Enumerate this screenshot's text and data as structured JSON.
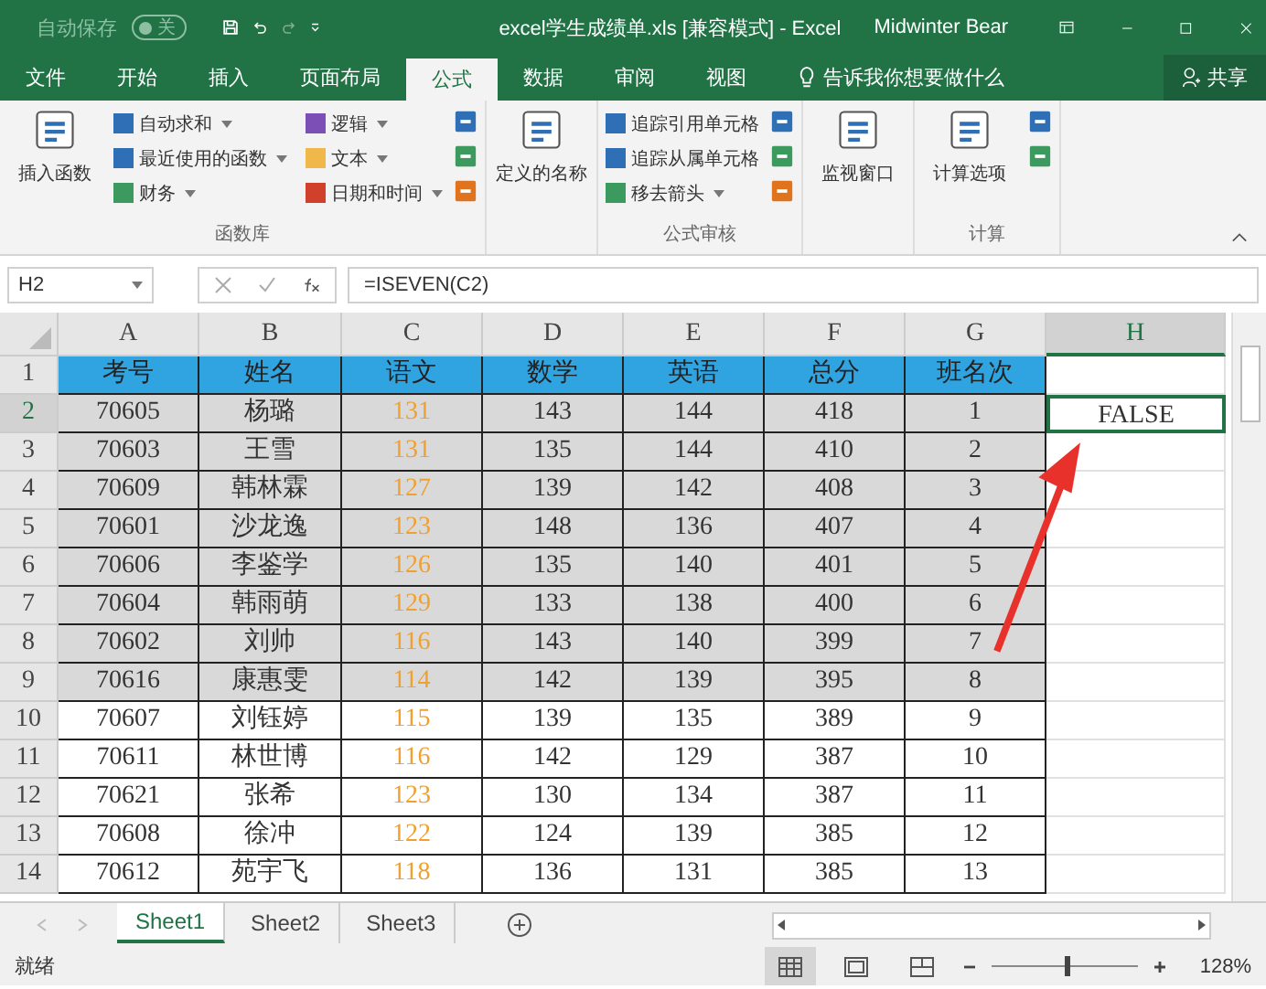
{
  "title_bar": {
    "autosave": {
      "label": "自动保存",
      "state_text": "关",
      "on": false
    },
    "title": "excel学生成绩单.xls  [兼容模式]  -  Excel",
    "user": "Midwinter Bear"
  },
  "menu_tabs": [
    {
      "label": "文件",
      "selected": false
    },
    {
      "label": "开始",
      "selected": false
    },
    {
      "label": "插入",
      "selected": false
    },
    {
      "label": "页面布局",
      "selected": false
    },
    {
      "label": "公式",
      "selected": true
    },
    {
      "label": "数据",
      "selected": false
    },
    {
      "label": "审阅",
      "selected": false
    },
    {
      "label": "视图",
      "selected": false
    }
  ],
  "tell_me": "告诉我你想要做什么",
  "share": "共享",
  "ribbon": {
    "groups": [
      {
        "label": "函数库",
        "large": [
          "插入函数"
        ],
        "small": [
          {
            "label": "自动求和",
            "dropdown": true
          },
          {
            "label": "最近使用的函数",
            "dropdown": true
          },
          {
            "label": "财务",
            "dropdown": true
          },
          {
            "label": "逻辑",
            "dropdown": true
          },
          {
            "label": "文本",
            "dropdown": true
          },
          {
            "label": "日期和时间",
            "dropdown": true
          }
        ]
      },
      {
        "large": [
          "定义的名称"
        ]
      },
      {
        "label": "公式审核",
        "small": [
          {
            "label": "追踪引用单元格",
            "dropdown": false
          },
          {
            "label": "追踪从属单元格",
            "dropdown": false
          },
          {
            "label": "移去箭头",
            "dropdown": true
          }
        ]
      },
      {
        "large": [
          "监视窗口"
        ]
      },
      {
        "label": "计算",
        "large": [
          "计算选项"
        ]
      }
    ]
  },
  "formula_bar": {
    "name_box": "H2",
    "formula": "=ISEVEN(C2)"
  },
  "columns": [
    {
      "label": "A",
      "selected": false
    },
    {
      "label": "B",
      "selected": false
    },
    {
      "label": "C",
      "selected": false
    },
    {
      "label": "D",
      "selected": false
    },
    {
      "label": "E",
      "selected": false
    },
    {
      "label": "F",
      "selected": false
    },
    {
      "label": "G",
      "selected": false
    },
    {
      "label": "H",
      "selected": true
    }
  ],
  "rows": [
    {
      "num": "1",
      "kind": "header",
      "selected": false,
      "cells": [
        "考号",
        "姓名",
        "语文",
        "数学",
        "英语",
        "总分",
        "班名次"
      ]
    },
    {
      "num": "2",
      "kind": "shaded",
      "selected": true,
      "cells": [
        "70605",
        "杨璐",
        "131",
        "143",
        "144",
        "418",
        "1",
        "FALSE"
      ]
    },
    {
      "num": "3",
      "kind": "shaded",
      "selected": false,
      "cells": [
        "70603",
        "王雪",
        "131",
        "135",
        "144",
        "410",
        "2"
      ]
    },
    {
      "num": "4",
      "kind": "shaded",
      "selected": false,
      "cells": [
        "70609",
        "韩林霖",
        "127",
        "139",
        "142",
        "408",
        "3"
      ]
    },
    {
      "num": "5",
      "kind": "shaded",
      "selected": false,
      "cells": [
        "70601",
        "沙龙逸",
        "123",
        "148",
        "136",
        "407",
        "4"
      ]
    },
    {
      "num": "6",
      "kind": "shaded",
      "selected": false,
      "cells": [
        "70606",
        "李鉴学",
        "126",
        "135",
        "140",
        "401",
        "5"
      ]
    },
    {
      "num": "7",
      "kind": "shaded",
      "selected": false,
      "cells": [
        "70604",
        "韩雨萌",
        "129",
        "133",
        "138",
        "400",
        "6"
      ]
    },
    {
      "num": "8",
      "kind": "shaded",
      "selected": false,
      "cells": [
        "70602",
        "刘帅",
        "116",
        "143",
        "140",
        "399",
        "7"
      ]
    },
    {
      "num": "9",
      "kind": "shaded",
      "selected": false,
      "cells": [
        "70616",
        "康惠雯",
        "114",
        "142",
        "139",
        "395",
        "8"
      ]
    },
    {
      "num": "10",
      "kind": "plain",
      "selected": false,
      "cells": [
        "70607",
        "刘钰婷",
        "115",
        "139",
        "135",
        "389",
        "9"
      ]
    },
    {
      "num": "11",
      "kind": "plain",
      "selected": false,
      "cells": [
        "70611",
        "林世博",
        "116",
        "142",
        "129",
        "387",
        "10"
      ]
    },
    {
      "num": "12",
      "kind": "plain",
      "selected": false,
      "cells": [
        "70621",
        "张希",
        "123",
        "130",
        "134",
        "387",
        "11"
      ]
    },
    {
      "num": "13",
      "kind": "plain",
      "selected": false,
      "cells": [
        "70608",
        "徐冲",
        "122",
        "124",
        "139",
        "385",
        "12"
      ]
    },
    {
      "num": "14",
      "kind": "plain",
      "selected": false,
      "cells": [
        "70612",
        "苑宇飞",
        "118",
        "136",
        "131",
        "385",
        "13"
      ]
    }
  ],
  "sheet_tabs": [
    {
      "label": "Sheet1",
      "selected": true
    },
    {
      "label": "Sheet2",
      "selected": false
    },
    {
      "label": "Sheet3",
      "selected": false
    }
  ],
  "status_bar": {
    "text": "就绪",
    "views": [
      {
        "selected": true
      },
      {
        "selected": false
      },
      {
        "selected": false
      }
    ],
    "zoom": {
      "level": 0.54,
      "text": "128%"
    }
  }
}
